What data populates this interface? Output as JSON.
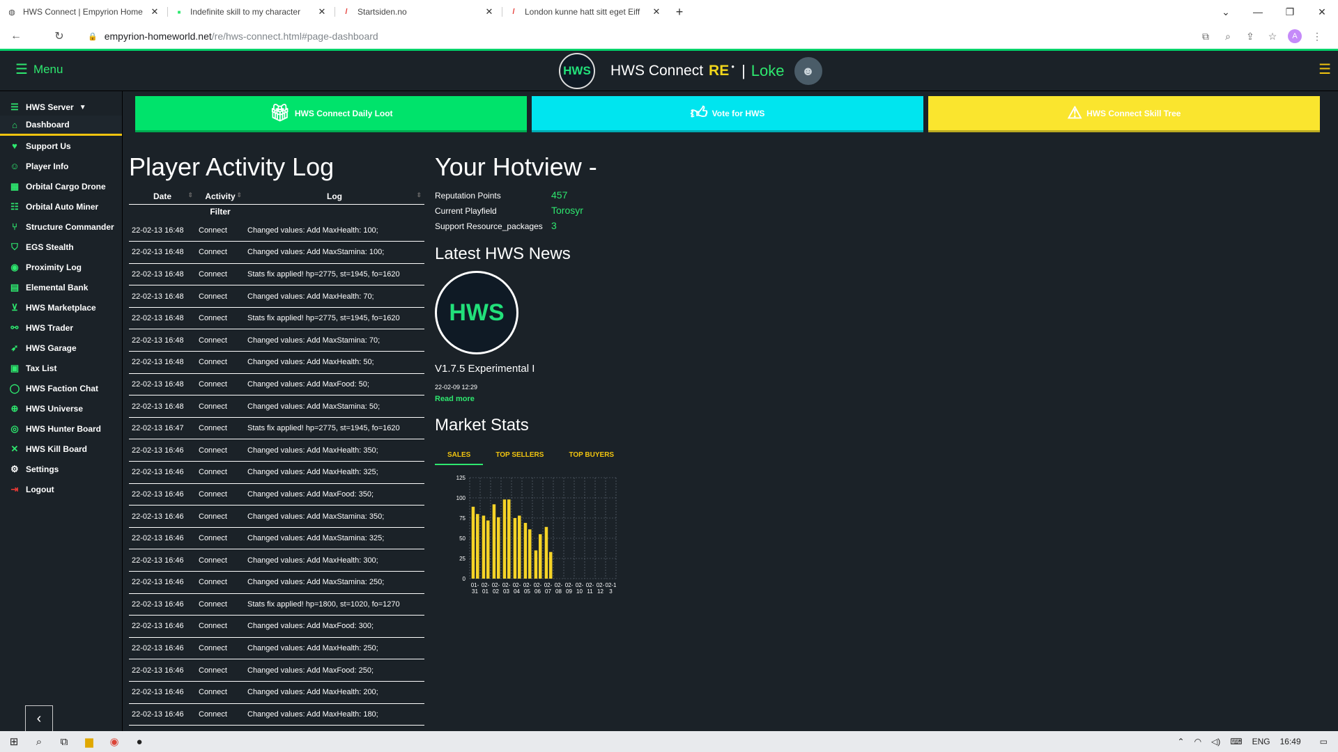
{
  "browser": {
    "tabs": [
      {
        "title": "HWS Connect | Empyrion Home"
      },
      {
        "title": "Indefinite skill to my character"
      },
      {
        "title": "Startsiden.no"
      },
      {
        "title": "London kunne hatt sitt eget Eiff"
      }
    ],
    "url_host": "empyrion-homeworld.net",
    "url_path": "/re/hws-connect.html#page-dashboard",
    "profile_initial": "A"
  },
  "header": {
    "menu_label": "Menu",
    "brand_title": "HWS Connect",
    "brand_re": "RE",
    "brand_sep": "|",
    "user_name": "Loke",
    "logo_text": "HWS"
  },
  "sidebar": {
    "server_label": "HWS Server",
    "items": [
      {
        "label": "Dashboard"
      },
      {
        "label": "Support Us"
      },
      {
        "label": "Player Info"
      },
      {
        "label": "Orbital Cargo Drone"
      },
      {
        "label": "Orbital Auto Miner"
      },
      {
        "label": "Structure Commander"
      },
      {
        "label": "EGS Stealth"
      },
      {
        "label": "Proximity Log"
      },
      {
        "label": "Elemental Bank"
      },
      {
        "label": "HWS Marketplace"
      },
      {
        "label": "HWS Trader"
      },
      {
        "label": "HWS Garage"
      },
      {
        "label": "Tax List"
      },
      {
        "label": "HWS Faction Chat"
      },
      {
        "label": "HWS Universe"
      },
      {
        "label": "HWS Hunter Board"
      },
      {
        "label": "HWS Kill Board"
      },
      {
        "label": "Settings"
      },
      {
        "label": "Logout"
      }
    ]
  },
  "topbuttons": {
    "daily_loot": "HWS Connect Daily Loot",
    "vote": "Vote for HWS",
    "skill_tree": "HWS Connect Skill Tree"
  },
  "activity": {
    "title": "Player Activity Log",
    "columns": [
      "Date",
      "Activity",
      "Log"
    ],
    "filter_label": "Filter",
    "rows": [
      [
        "22-02-13 16:48",
        "Connect",
        "Changed values: Add MaxHealth: 100;"
      ],
      [
        "22-02-13 16:48",
        "Connect",
        "Changed values: Add MaxStamina: 100;"
      ],
      [
        "22-02-13 16:48",
        "Connect",
        "Stats fix applied! hp=2775, st=1945, fo=1620"
      ],
      [
        "22-02-13 16:48",
        "Connect",
        "Changed values: Add MaxHealth: 70;"
      ],
      [
        "22-02-13 16:48",
        "Connect",
        "Stats fix applied! hp=2775, st=1945, fo=1620"
      ],
      [
        "22-02-13 16:48",
        "Connect",
        "Changed values: Add MaxStamina: 70;"
      ],
      [
        "22-02-13 16:48",
        "Connect",
        "Changed values: Add MaxHealth: 50;"
      ],
      [
        "22-02-13 16:48",
        "Connect",
        "Changed values: Add MaxFood: 50;"
      ],
      [
        "22-02-13 16:48",
        "Connect",
        "Changed values: Add MaxStamina: 50;"
      ],
      [
        "22-02-13 16:47",
        "Connect",
        "Stats fix applied! hp=2775, st=1945, fo=1620"
      ],
      [
        "22-02-13 16:46",
        "Connect",
        "Changed values: Add MaxHealth: 350;"
      ],
      [
        "22-02-13 16:46",
        "Connect",
        "Changed values: Add MaxHealth: 325;"
      ],
      [
        "22-02-13 16:46",
        "Connect",
        "Changed values: Add MaxFood: 350;"
      ],
      [
        "22-02-13 16:46",
        "Connect",
        "Changed values: Add MaxStamina: 350;"
      ],
      [
        "22-02-13 16:46",
        "Connect",
        "Changed values: Add MaxStamina: 325;"
      ],
      [
        "22-02-13 16:46",
        "Connect",
        "Changed values: Add MaxHealth: 300;"
      ],
      [
        "22-02-13 16:46",
        "Connect",
        "Changed values: Add MaxStamina: 250;"
      ],
      [
        "22-02-13 16:46",
        "Connect",
        "Stats fix applied! hp=1800, st=1020, fo=1270"
      ],
      [
        "22-02-13 16:46",
        "Connect",
        "Changed values: Add MaxFood: 300;"
      ],
      [
        "22-02-13 16:46",
        "Connect",
        "Changed values: Add MaxHealth: 250;"
      ],
      [
        "22-02-13 16:46",
        "Connect",
        "Changed values: Add MaxFood: 250;"
      ],
      [
        "22-02-13 16:46",
        "Connect",
        "Changed values: Add MaxHealth: 200;"
      ],
      [
        "22-02-13 16:46",
        "Connect",
        "Changed values: Add MaxHealth: 180;"
      ]
    ]
  },
  "hotview": {
    "title": "Your Hotview -",
    "reputation_label": "Reputation Points",
    "reputation_value": "457",
    "playfield_label": "Current Playfield",
    "playfield_value": "Torosyr",
    "packages_label": "Support Resource_packages",
    "packages_value": "3"
  },
  "news": {
    "title": "Latest HWS News",
    "logo_text": "HWS",
    "item_title": "V1.7.5 Experimental I",
    "item_date": "22-02-09 12:29",
    "read_more": "Read more"
  },
  "market": {
    "title": "Market Stats",
    "tabs": [
      "SALES",
      "TOP SELLERS",
      "TOP BUYERS"
    ]
  },
  "chart_data": {
    "type": "bar",
    "categories": [
      "01-31",
      "02-01",
      "02-02",
      "02-03",
      "02-04",
      "02-05",
      "02-06",
      "02-07",
      "02-08",
      "02-09",
      "02-10",
      "02-11",
      "02-12",
      "02-13"
    ],
    "tick_labels": [
      [
        "01-",
        "31"
      ],
      [
        "02-",
        "01"
      ],
      [
        "02-",
        "02"
      ],
      [
        "02-",
        "03"
      ],
      [
        "02-",
        "04"
      ],
      [
        "02-",
        "05"
      ],
      [
        "02-",
        "06"
      ],
      [
        "02-",
        "07"
      ],
      [
        "02-",
        "08"
      ],
      [
        "02-",
        "09"
      ],
      [
        "02-",
        "10"
      ],
      [
        "02-",
        "11"
      ],
      [
        "02-",
        "12"
      ],
      [
        "02-1",
        "3"
      ]
    ],
    "series": [
      {
        "values": [
          [
            89,
            80
          ],
          [
            78,
            72
          ],
          [
            92,
            76
          ],
          [
            98,
            98
          ],
          [
            75,
            78
          ],
          [
            69,
            61
          ],
          [
            35,
            55
          ],
          [
            64,
            33
          ]
        ]
      }
    ],
    "ylim": [
      0,
      125
    ],
    "yticks": [
      0,
      25,
      50,
      75,
      100,
      125
    ],
    "grid": true,
    "bar_color": "#f5d327"
  },
  "taskbar": {
    "lang": "ENG",
    "time": "16:49"
  },
  "colors": {
    "accent_green": "#2ee86f",
    "accent_yellow": "#f1c40f",
    "bg": "#1b2228"
  }
}
